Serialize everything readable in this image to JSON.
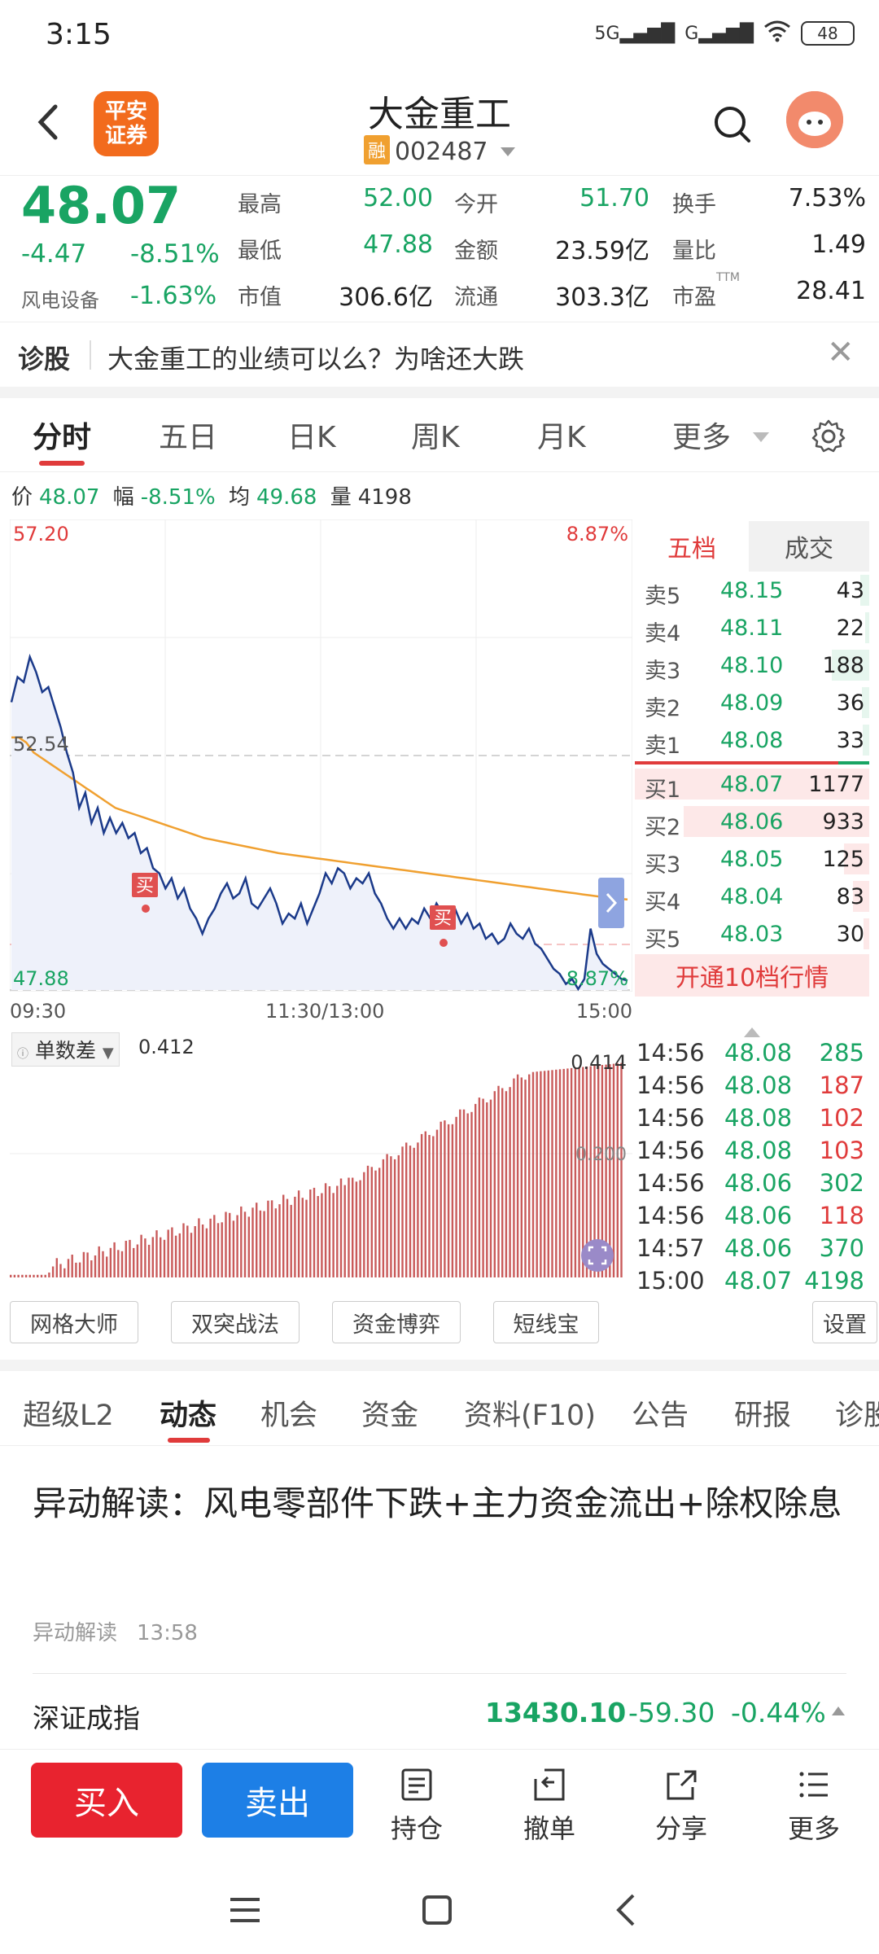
{
  "status": {
    "time": "3:15",
    "signal1": "5G",
    "signal2": "G",
    "battery": "48"
  },
  "header": {
    "logo_line1": "平安",
    "logo_line2": "证券",
    "title": "大金重工",
    "badge": "融",
    "code": "002487"
  },
  "quote": {
    "price": "48.07",
    "change": "-4.47",
    "change_pct": "-8.51%",
    "sector": "风电设备",
    "sector_pct": "-1.63%",
    "fields": [
      {
        "label": "最高",
        "value": "52.00"
      },
      {
        "label": "今开",
        "value": "51.70"
      },
      {
        "label": "换手",
        "value": "7.53%"
      },
      {
        "label": "最低",
        "value": "47.88"
      },
      {
        "label": "金额",
        "value": "23.59亿"
      },
      {
        "label": "量比",
        "value": "1.49"
      },
      {
        "label": "市值",
        "value": "306.6亿"
      },
      {
        "label": "流通",
        "value": "303.3亿"
      },
      {
        "label": "市盈",
        "value": "28.41"
      }
    ],
    "ttm": "TTM"
  },
  "diagnosis": {
    "tag": "诊股",
    "text": "大金重工的业绩可以么？为啥还大跌"
  },
  "chart_tabs": [
    "分时",
    "五日",
    "日K",
    "周K",
    "月K",
    "更多"
  ],
  "info_line": {
    "p_label": "价",
    "p": "48.07",
    "f_label": "幅",
    "f": "-8.51%",
    "avg_label": "均",
    "avg": "49.68",
    "vol_label": "量",
    "vol": "4198"
  },
  "chart_data": {
    "type": "line",
    "title": "",
    "y_top": "57.20",
    "y_mid": "52.54",
    "y_bottom": "47.88",
    "pct_top": "8.87%",
    "pct_bottom": "8.87%",
    "x_ticks": [
      "09:30",
      "11:30/13:00",
      "15:00"
    ],
    "ylim": [
      47.88,
      57.2
    ],
    "prev_close": 52.54,
    "series": [
      {
        "values": [
          53.6,
          54.1,
          54.0,
          54.5,
          54.2,
          53.8,
          53.9,
          53.5,
          53.1,
          52.6,
          52.2,
          51.5,
          51.8,
          51.2,
          51.5,
          51.0,
          51.3,
          51.0,
          51.2,
          50.9,
          51.0,
          50.6,
          50.7,
          50.3,
          50.2,
          49.9,
          50.1,
          49.7,
          49.9,
          49.5,
          49.3,
          49.0,
          49.3,
          49.5,
          49.8,
          50.0,
          49.7,
          49.8,
          50.1,
          49.6,
          49.5,
          49.7,
          49.9,
          49.6,
          49.2,
          49.4,
          49.3,
          49.6,
          49.2,
          49.5,
          49.8,
          50.2,
          50.0,
          50.3,
          50.2,
          49.9,
          50.1,
          50.0,
          50.2,
          49.8,
          49.6,
          49.3,
          49.1,
          49.3,
          49.1,
          49.3,
          49.2,
          49.5,
          49.3,
          49.6,
          49.4,
          49.3,
          49.5,
          49.2,
          49.4,
          49.1,
          49.2,
          48.9,
          49.0,
          48.8,
          48.9,
          49.2,
          49.0,
          48.9,
          49.1,
          48.8,
          48.7,
          48.5,
          48.3,
          48.2,
          48.0,
          48.1,
          47.9,
          48.1,
          49.1,
          48.6,
          48.4,
          48.3,
          48.2,
          48.1,
          48.07
        ]
      },
      {
        "values": [
          52.9,
          52.9,
          52.8,
          52.6,
          52.5,
          52.4,
          52.3,
          52.2,
          52.1,
          52.0,
          51.9,
          51.8,
          51.7,
          51.6,
          51.5,
          51.45,
          51.4,
          51.35,
          51.3,
          51.25,
          51.2,
          51.15,
          51.1,
          51.05,
          51.0,
          50.95,
          50.9,
          50.87,
          50.84,
          50.81,
          50.78,
          50.75,
          50.72,
          50.69,
          50.66,
          50.63,
          50.6,
          50.58,
          50.56,
          50.54,
          50.52,
          50.5,
          50.48,
          50.46,
          50.44,
          50.42,
          50.4,
          50.38,
          50.36,
          50.34,
          50.32,
          50.3,
          50.28,
          50.26,
          50.24,
          50.22,
          50.2,
          50.18,
          50.16,
          50.14,
          50.12,
          50.1,
          50.08,
          50.06,
          50.04,
          50.02,
          50.0,
          49.98,
          49.96,
          49.94,
          49.92,
          49.9,
          49.88,
          49.86,
          49.84,
          49.82,
          49.8,
          49.78,
          49.76,
          49.74,
          49.72,
          49.7,
          49.69,
          49.68
        ]
      }
    ],
    "markers": [
      "买",
      "买"
    ]
  },
  "indicator": {
    "name": "单数差",
    "value": "0.412",
    "top_label": "0.414",
    "mid_label": "0.200"
  },
  "book": {
    "tabs": [
      "五档",
      "成交"
    ],
    "asks": [
      {
        "label": "卖5",
        "price": "48.15",
        "vol": "43"
      },
      {
        "label": "卖4",
        "price": "48.11",
        "vol": "22"
      },
      {
        "label": "卖3",
        "price": "48.10",
        "vol": "188"
      },
      {
        "label": "卖2",
        "price": "48.09",
        "vol": "36"
      },
      {
        "label": "卖1",
        "price": "48.08",
        "vol": "33"
      }
    ],
    "bids": [
      {
        "label": "买1",
        "price": "48.07",
        "vol": "1177"
      },
      {
        "label": "买2",
        "price": "48.06",
        "vol": "933"
      },
      {
        "label": "买3",
        "price": "48.05",
        "vol": "125"
      },
      {
        "label": "买4",
        "price": "48.04",
        "vol": "83"
      },
      {
        "label": "买5",
        "price": "48.03",
        "vol": "30"
      }
    ],
    "upgrade": "开通10档行情"
  },
  "trades": [
    {
      "time": "14:56",
      "price": "48.08",
      "vol": "285",
      "side": "green"
    },
    {
      "time": "14:56",
      "price": "48.08",
      "vol": "187",
      "side": "red"
    },
    {
      "time": "14:56",
      "price": "48.08",
      "vol": "102",
      "side": "red"
    },
    {
      "time": "14:56",
      "price": "48.08",
      "vol": "103",
      "side": "red"
    },
    {
      "time": "14:56",
      "price": "48.06",
      "vol": "302",
      "side": "green"
    },
    {
      "time": "14:56",
      "price": "48.06",
      "vol": "118",
      "side": "red"
    },
    {
      "time": "14:57",
      "price": "48.06",
      "vol": "370",
      "side": "green"
    },
    {
      "time": "15:00",
      "price": "48.07",
      "vol": "4198",
      "side": "green"
    }
  ],
  "tools": [
    "网格大师",
    "双突战法",
    "资金博弈",
    "短线宝",
    "设置"
  ],
  "detail_tabs": [
    "超级L2",
    "动态",
    "机会",
    "资金",
    "资料(F10)",
    "公告",
    "研报",
    "诊股"
  ],
  "news": {
    "title": "异动解读：风电零部件下跌+主力资金流出+除权除息",
    "source": "异动解读",
    "time": "13:58"
  },
  "index": {
    "name": "深证成指",
    "value": "13430.10",
    "change": "-59.30",
    "pct": "-0.44%"
  },
  "bottom": {
    "buy": "买入",
    "sell": "卖出",
    "hold": "持仓",
    "cancel": "撤单",
    "share": "分享",
    "more": "更多"
  },
  "colors": {
    "green": "#19a463",
    "red": "#e03b3b",
    "avg_line": "#f0a030",
    "price_line": "#1b3a8a",
    "buy_btn": "#e8232f",
    "sell_btn": "#1d7fe6"
  }
}
